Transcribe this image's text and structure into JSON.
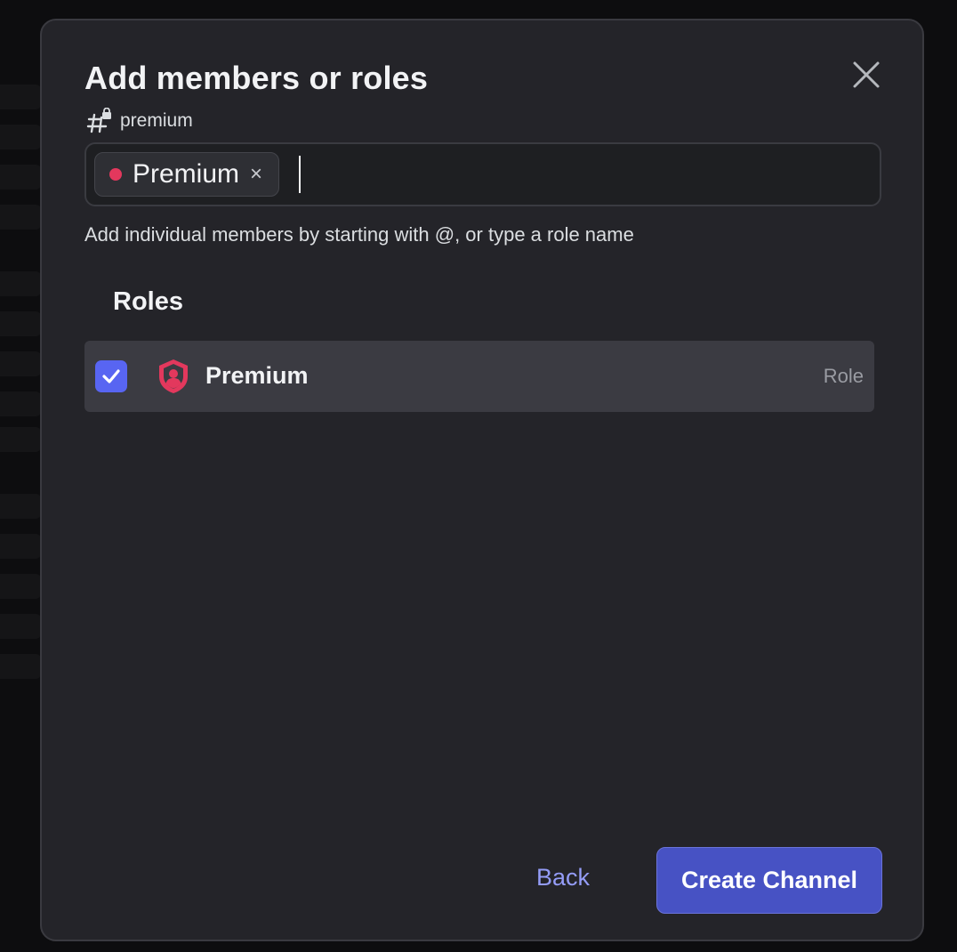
{
  "modal": {
    "title": "Add members or roles",
    "channel_name": "premium"
  },
  "search": {
    "chip_label": "Premium",
    "chip_remove": "×",
    "value": "",
    "placeholder": ""
  },
  "hint": "Add individual members by starting with @, or type a role name",
  "roles_section": {
    "title": "Roles",
    "items": [
      {
        "name": "Premium",
        "type": "Role",
        "checked": true
      }
    ]
  },
  "footer": {
    "back_label": "Back",
    "create_label": "Create Channel"
  },
  "colors": {
    "accent": "#5865f2",
    "role_color": "#e3385d"
  }
}
